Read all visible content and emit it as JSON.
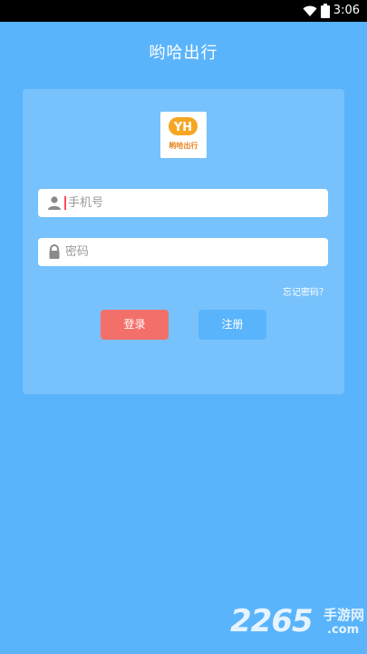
{
  "status_bar": {
    "time": "3:06"
  },
  "header": {
    "title": "哟哈出行"
  },
  "logo": {
    "mark_text": "YH",
    "text": "哟哈出行"
  },
  "form": {
    "phone": {
      "placeholder": "手机号",
      "icon": "user-icon"
    },
    "password": {
      "placeholder": "密码",
      "icon": "lock-icon"
    },
    "forgot_label": "忘记密码？"
  },
  "buttons": {
    "login_label": "登录",
    "register_label": "注册"
  },
  "watermark": {
    "number": "2265",
    "cn": "手游网",
    "com": ".com"
  },
  "colors": {
    "background": "#5ab4fb",
    "card": "#77c2fd",
    "login_button": "#f3706a",
    "register_button": "#5ab4fb",
    "logo_accent": "#f5a623"
  }
}
